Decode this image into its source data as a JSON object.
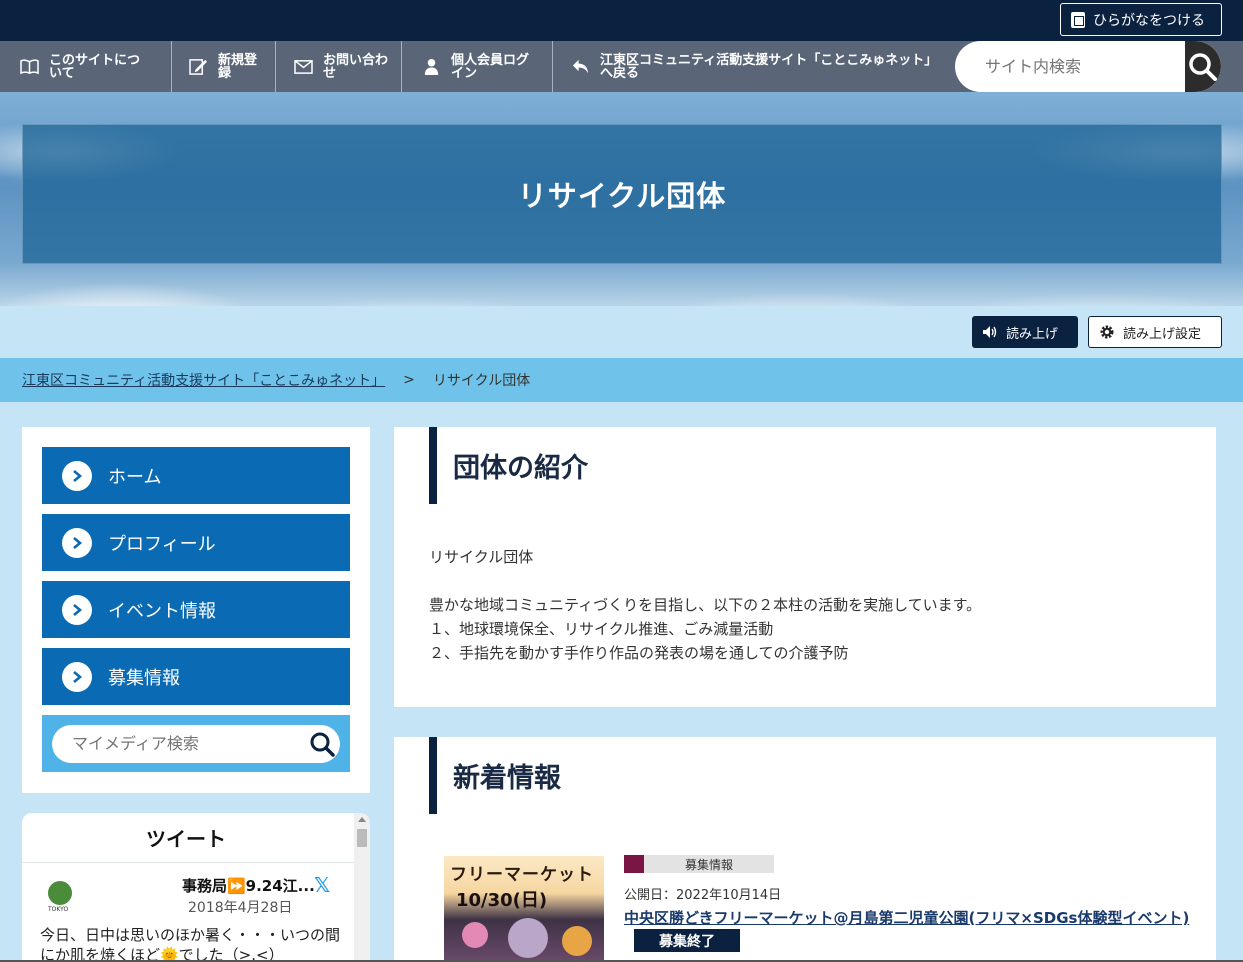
{
  "top_bar": {
    "hiragana_button": "ひらがなをつける"
  },
  "nav": {
    "items": [
      {
        "label": "このサイトについて",
        "icon": "book-icon"
      },
      {
        "label": "新規登録",
        "icon": "edit-icon"
      },
      {
        "label": "お問い合わせ",
        "icon": "mail-icon"
      },
      {
        "label": "個人会員ログイン",
        "icon": "user-icon"
      },
      {
        "label": "江東区コミュニティ活動支援サイト「ことこみゅネット」へ戻る",
        "icon": "return-icon"
      }
    ],
    "search_placeholder": "サイト内検索"
  },
  "hero": {
    "title": "リサイクル団体"
  },
  "read_aloud": {
    "read_label": "読み上げ",
    "settings_label": "読み上げ設定"
  },
  "breadcrumb": {
    "home": "江東区コミュニティ活動支援サイト「ことこみゅネット」",
    "separator": ">",
    "current": "リサイクル団体"
  },
  "sidebar": {
    "items": [
      {
        "label": "ホーム"
      },
      {
        "label": "プロフィール"
      },
      {
        "label": "イベント情報"
      },
      {
        "label": "募集情報"
      }
    ],
    "search_placeholder": "マイメディア検索"
  },
  "twitter": {
    "header": "ツイート",
    "avatar_text": "TOKYO",
    "user": "事務局⏩9.24江...",
    "date": "2018年4月28日",
    "text": "今日、日中は思いのほか暑く・・・いつの間にか肌を焼くほど🌞でした（>.<）"
  },
  "intro": {
    "title": "団体の紹介",
    "lines": [
      "リサイクル団体",
      "",
      "豊かな地域コミュニティづくりを目指し、以下の２本柱の活動を実施しています。",
      " １、地球環境保全、リサイクル推進、ごみ減量活動",
      " ２、手指先を動かす手作り作品の発表の場を通しての介護予防"
    ]
  },
  "news": {
    "title": "新着情報",
    "item": {
      "image_text_1": "フリーマーケット",
      "image_text_2": "10/30(日)",
      "category": "募集情報",
      "published": "公開日：2022年10月14日",
      "link": "中央区勝どきフリーマーケット@月島第二児童公園(フリマ×SDGs体験型イベント)",
      "status": "募集終了"
    }
  },
  "colors": {
    "navy": "#0b2140",
    "sidebar_button": "#0a6ab4",
    "breadcrumb_bg": "#6fc3ea",
    "page_bg": "#c5e4f6",
    "category_swatch": "#7a1544"
  }
}
